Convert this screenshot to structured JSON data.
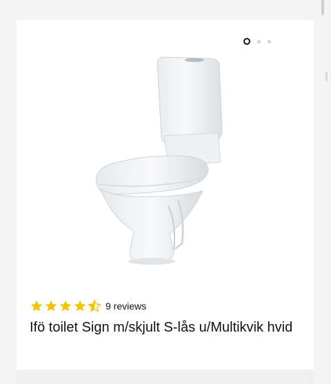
{
  "carousel": {
    "slides": 3,
    "active_index": 0
  },
  "product": {
    "image_icon": "toilet-icon",
    "rating": 4.5,
    "rating_max": 5,
    "reviews_label": "9 reviews",
    "title": "Ifö toilet Sign m/skjult S-lås u/Multikvik hvid"
  },
  "colors": {
    "star": "#f5c400",
    "text": "#111111",
    "card": "#ffffff",
    "background": "#f4f4f4"
  }
}
